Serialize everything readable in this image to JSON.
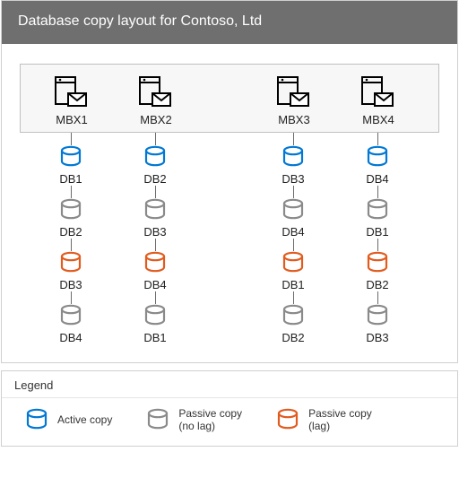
{
  "title": "Database copy layout for Contoso, Ltd",
  "columns": [
    {
      "server": "MBX1",
      "dbs": [
        {
          "label": "DB1",
          "copy": "active"
        },
        {
          "label": "DB2",
          "copy": "passive"
        },
        {
          "label": "DB3",
          "copy": "lag"
        },
        {
          "label": "DB4",
          "copy": "passive"
        }
      ]
    },
    {
      "server": "MBX2",
      "dbs": [
        {
          "label": "DB2",
          "copy": "active"
        },
        {
          "label": "DB3",
          "copy": "passive"
        },
        {
          "label": "DB4",
          "copy": "lag"
        },
        {
          "label": "DB1",
          "copy": "passive"
        }
      ]
    },
    {
      "server": "MBX3",
      "dbs": [
        {
          "label": "DB3",
          "copy": "active"
        },
        {
          "label": "DB4",
          "copy": "passive"
        },
        {
          "label": "DB1",
          "copy": "lag"
        },
        {
          "label": "DB2",
          "copy": "passive"
        }
      ]
    },
    {
      "server": "MBX4",
      "dbs": [
        {
          "label": "DB4",
          "copy": "active"
        },
        {
          "label": "DB1",
          "copy": "passive"
        },
        {
          "label": "DB2",
          "copy": "lag"
        },
        {
          "label": "DB3",
          "copy": "passive"
        }
      ]
    }
  ],
  "legend": {
    "title": "Legend",
    "items": [
      {
        "copy": "active",
        "label": "Active copy"
      },
      {
        "copy": "passive",
        "label": "Passive copy\n(no lag)"
      },
      {
        "copy": "lag",
        "label": "Passive copy\n(lag)"
      }
    ]
  },
  "colors": {
    "active": "#0078d4",
    "passive": "#8a8a8a",
    "lag": "#e25b1e"
  }
}
